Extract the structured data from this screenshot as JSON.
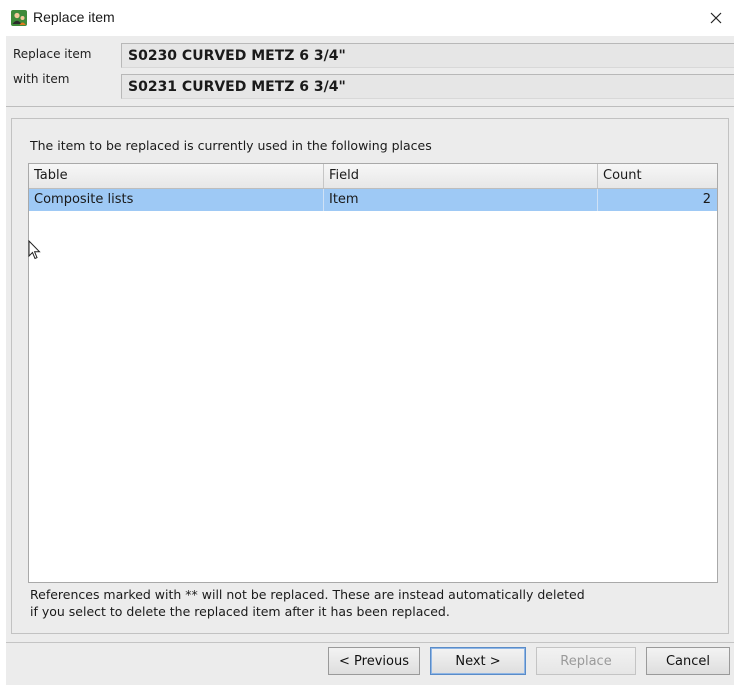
{
  "window": {
    "title": "Replace item",
    "app_icon": "user-group-icon",
    "close_icon": "close-icon"
  },
  "replace": {
    "replace_label": "Replace item",
    "replace_value": "S0230 CURVED METZ 6 3/4\"",
    "with_label": "with item",
    "with_value": "S0231 CURVED METZ 6 3/4\""
  },
  "usage": {
    "description": "The item to be replaced is currently used in the following places",
    "columns": [
      "Table",
      "Field",
      "Count"
    ],
    "rows": [
      {
        "table": "Composite lists",
        "field": "Item",
        "count": "2"
      }
    ],
    "selected_row": 0,
    "selection_color": "#9ec9f5"
  },
  "note": {
    "line1": "References marked with ** will not be replaced. These are instead automatically deleted",
    "line2": "if you select to delete the replaced item after it has been replaced."
  },
  "buttons": {
    "previous": "< Previous",
    "next": "Next >",
    "replace": "Replace",
    "cancel": "Cancel"
  }
}
